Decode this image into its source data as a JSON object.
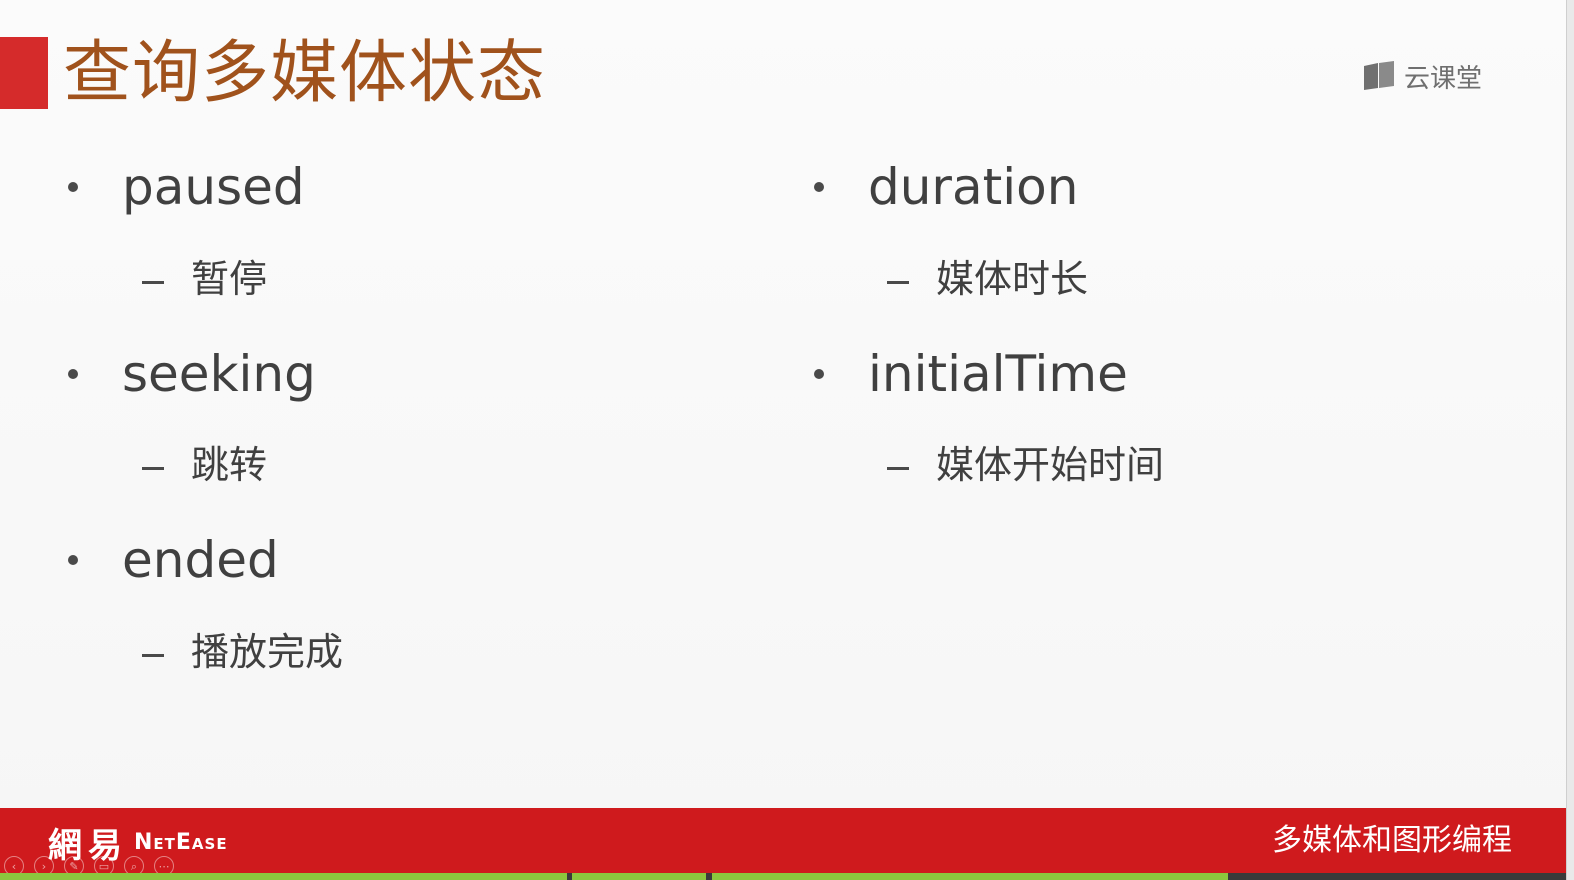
{
  "slide": {
    "title": "查询多媒体状态",
    "brand": "云课堂",
    "left_items": [
      {
        "term": "paused",
        "desc": "暂停"
      },
      {
        "term": "seeking",
        "desc": "跳转"
      },
      {
        "term": "ended",
        "desc": "播放完成"
      }
    ],
    "right_items": [
      {
        "term": "duration",
        "desc": "媒体时长"
      },
      {
        "term": "initialTime",
        "desc": "媒体开始时间"
      }
    ]
  },
  "footer": {
    "logo_cn": "網易",
    "logo_en": "NetEase",
    "course_title": "多媒体和图形编程"
  },
  "player_controls": [
    {
      "icon": "prev-icon",
      "glyph": "‹"
    },
    {
      "icon": "next-icon",
      "glyph": "›"
    },
    {
      "icon": "pen-icon",
      "glyph": "✎"
    },
    {
      "icon": "slides-icon",
      "glyph": "▭"
    },
    {
      "icon": "zoom-icon",
      "glyph": "⌕"
    },
    {
      "icon": "more-icon",
      "glyph": "⋯"
    }
  ],
  "colors": {
    "accent": "#d52b2b",
    "title": "#a0521c",
    "footer": "#cf1a1d",
    "text": "#404040",
    "progress": "#8cc63e"
  }
}
